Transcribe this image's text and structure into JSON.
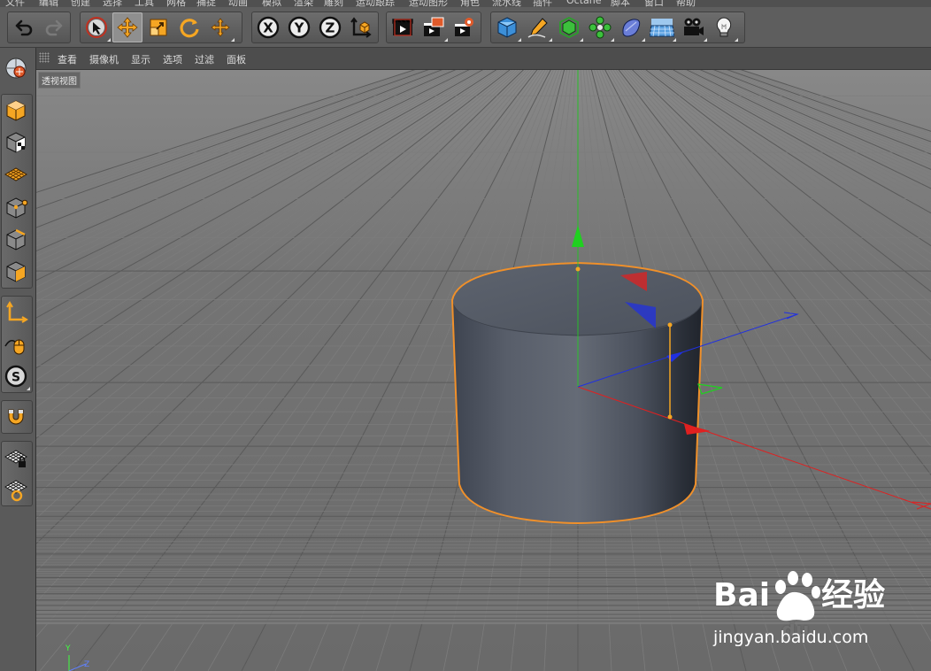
{
  "menubar": {
    "items": [
      "文件",
      "编辑",
      "创建",
      "选择",
      "工具",
      "网格",
      "捕捉",
      "动画",
      "模拟",
      "渲染",
      "雕刻",
      "运动跟踪",
      "运动图形",
      "角色",
      "流水线",
      "插件",
      "Octane",
      "脚本",
      "窗口",
      "帮助"
    ]
  },
  "toolbar": {
    "groups": [
      {
        "id": "history",
        "buttons": [
          "undo-icon",
          "redo-icon"
        ]
      },
      {
        "id": "tools",
        "buttons": [
          "select-icon",
          "move-icon",
          "scale-icon",
          "rotate-icon",
          "recent-tool-icon"
        ]
      },
      {
        "id": "axes",
        "buttons": [
          "x-axis-lock",
          "y-axis-lock",
          "z-axis-lock",
          "coordinate-system-icon"
        ],
        "labels": [
          "X",
          "Y",
          "Z"
        ]
      },
      {
        "id": "render",
        "buttons": [
          "render-view-icon",
          "render-to-picture-viewer-icon",
          "render-settings-icon"
        ]
      },
      {
        "id": "create",
        "buttons": [
          "cube-icon",
          "pen-icon",
          "subdivision-icon",
          "cloner-icon",
          "deformer-icon",
          "floor-icon",
          "camera-icon",
          "light-icon"
        ]
      }
    ]
  },
  "leftbar": {
    "buttons": [
      "make-editable-icon",
      "model-mode-icon",
      "texture-mode-icon",
      "workplane-icon",
      "points-mode-icon",
      "edges-mode-icon",
      "polygons-mode-icon",
      "axis-mode-icon",
      "tweak-mode-icon",
      "solo-icon",
      "snap-icon",
      "locked-workplane-icon",
      "planar-workplane-icon"
    ]
  },
  "viewport_menu": {
    "items": [
      "查看",
      "摄像机",
      "显示",
      "选项",
      "过滤",
      "面板"
    ]
  },
  "viewport": {
    "label": "透视视图",
    "axis_indicator": {
      "y": "Y",
      "z": "Z"
    }
  },
  "colors": {
    "x_axis": "#e02020",
    "y_axis": "#20d020",
    "z_axis": "#2030e0",
    "selection": "#f0902a",
    "grid_bg": "#6e6e6e"
  },
  "watermark": {
    "brand": "Bai",
    "brand_suffix": "du",
    "brand_cn": "经验",
    "url": "jingyan.baidu.com"
  }
}
